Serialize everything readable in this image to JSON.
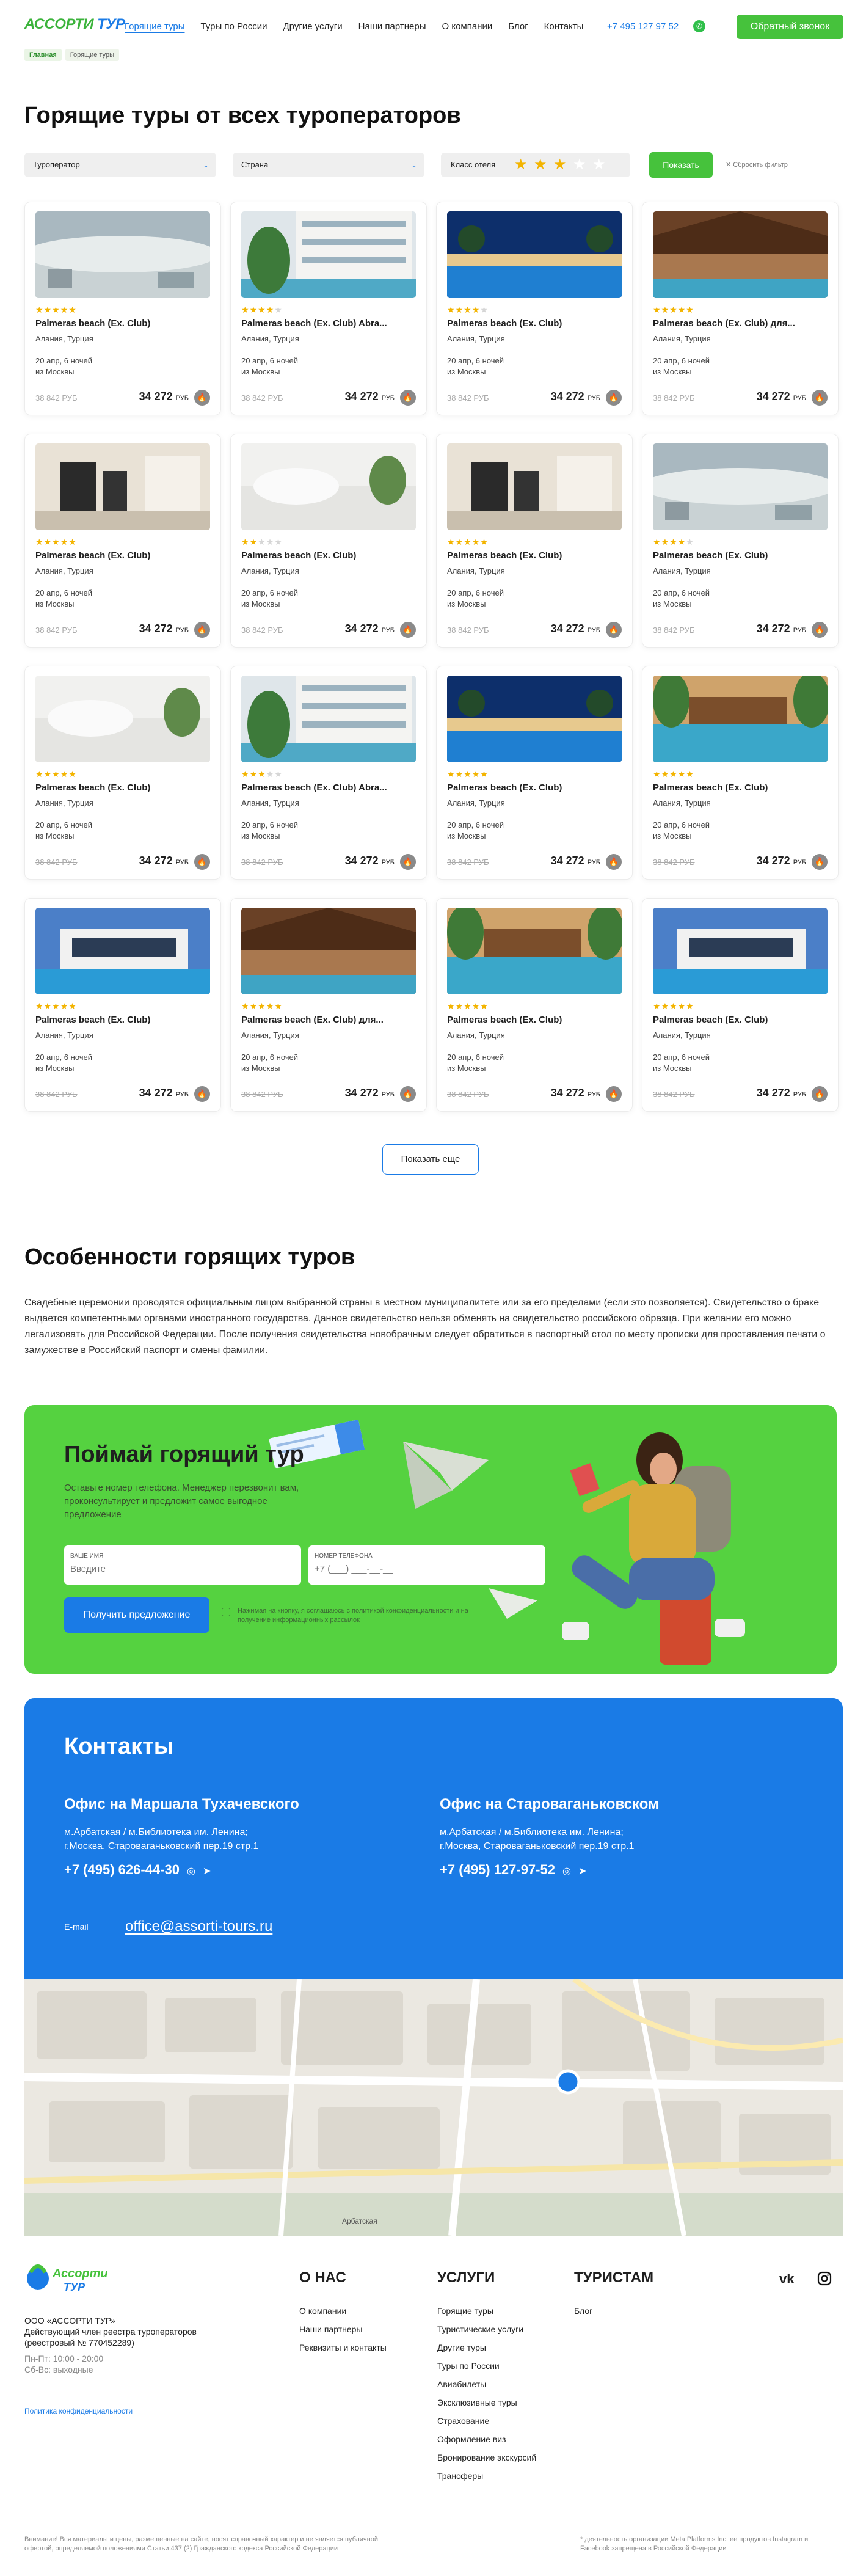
{
  "header": {
    "logo_text_a": "АССОРТИ",
    "logo_text_b": "ТУР",
    "nav": [
      "Горящие туры",
      "Туры по России",
      "Другие услуги",
      "Наши партнеры",
      "О компании",
      "Блог",
      "Контакты"
    ],
    "active_nav": "Горящие туры",
    "phone": "+7 495 127 97 52",
    "callback_label": "Обратный звонок"
  },
  "breadcrumbs": [
    "Главная",
    "Горящие туры"
  ],
  "page_title": "Горящие туры от всех туроператоров",
  "filters": {
    "operator": "Туроператор",
    "country": "Страна",
    "hotel_class": "Класс отеля",
    "stars_selected": 3,
    "stars_total": 5,
    "show_label": "Показать",
    "reset_label": "Сбросить фильтр"
  },
  "colors": {
    "green": "#46c23c",
    "blue": "#1a7be6",
    "star": "#f3b400"
  },
  "tours": [
    {
      "name": "Palmeras beach (Ex. Club)",
      "stars": 5,
      "img": "fog"
    },
    {
      "name": "Palmeras beach (Ex. Club) Abra...",
      "stars": 4,
      "img": "hotel"
    },
    {
      "name": "Palmeras beach (Ex. Club)",
      "stars": 4,
      "img": "pool-night"
    },
    {
      "name": "Palmeras beach (Ex. Club) для...",
      "stars": 5,
      "img": "wood"
    },
    {
      "name": "Palmeras beach (Ex. Club)",
      "stars": 5,
      "img": "bath"
    },
    {
      "name": "Palmeras beach (Ex. Club)",
      "stars": 2,
      "img": "bed"
    },
    {
      "name": "Palmeras beach (Ex. Club)",
      "stars": 5,
      "img": "bath"
    },
    {
      "name": "Palmeras beach (Ex. Club)",
      "stars": 4,
      "img": "fog"
    },
    {
      "name": "Palmeras beach (Ex. Club)",
      "stars": 5,
      "img": "bed"
    },
    {
      "name": "Palmeras beach (Ex. Club) Abra...",
      "stars": 3,
      "img": "hotel"
    },
    {
      "name": "Palmeras beach (Ex. Club)",
      "stars": 5,
      "img": "pool-night"
    },
    {
      "name": "Palmeras beach (Ex. Club)",
      "stars": 5,
      "img": "tropic"
    },
    {
      "name": "Palmeras beach (Ex. Club)",
      "stars": 5,
      "img": "villa"
    },
    {
      "name": "Palmeras beach (Ex. Club) для...",
      "stars": 5,
      "img": "wood"
    },
    {
      "name": "Palmeras beach (Ex. Club)",
      "stars": 5,
      "img": "tropic"
    },
    {
      "name": "Palmeras beach (Ex. Club)",
      "stars": 5,
      "img": "villa"
    }
  ],
  "tour_common": {
    "location": "Алания, Турция",
    "date": "20 апр, 6 ночей",
    "from": "из Москвы",
    "old_price": "38 842 РУБ",
    "price": "34 272",
    "currency": "РУБ"
  },
  "show_more": "Показать еще",
  "features": {
    "title": "Особенности горящих туров",
    "text": "Свадебные церемонии проводятся официальным лицом выбранной страны в местном муниципалитете или за его пределами (если это позволяется). Свидетельство о браке выдается компетентными органами иностранного государства. Данное свидетельство нельзя обменять на свидетельство российского образца. При желании его можно легализовать для Российской Федерации. После получения свидетельства новобрачным следует обратиться в паспортный стол по месту прописки для проставления печати о замужестве в Российский паспорт и смены фамилии."
  },
  "promo": {
    "title": "Поймай горящий тур",
    "desc": "Оставьте номер телефона. Менеджер перезвонит вам, проконсультирует и предложит самое выгодное предложение",
    "name_label": "Ваше имя",
    "name_placeholder": "Введите",
    "phone_label": "Номер телефона",
    "phone_placeholder": "+7 (___) ___-__-__",
    "button": "Получить предложение",
    "agree": "Нажимая на кнопку, я соглашаюсь с политикой конфиденциальности и на получение информационных рассылок"
  },
  "contacts": {
    "title": "Контакты",
    "offices": [
      {
        "name": "Офис на Маршала Тухачевского",
        "line1": "м.Арбатская / м.Библиотека им. Ленина;",
        "line2": "г.Москва, Староваганьковский пер.19 стр.1",
        "phone": "+7 (495) 626-44-30"
      },
      {
        "name": "Офис на Староваганьковском",
        "line1": "м.Арбатская / м.Библиотека им. Ленина;",
        "line2": "г.Москва, Староваганьковский пер.19 стр.1",
        "phone": "+7 (495) 127-97-52"
      }
    ],
    "email_label": "E-mail",
    "email": "office@assorti-tours.ru"
  },
  "footer": {
    "logo_a": "Ассорти",
    "logo_b": "ТУР",
    "company": "ООО «АССОРТИ ТУР»",
    "member": "Действующий член реестра туроператоров (реестровый № 770452289)",
    "hours1": "Пн-Пт: 10:00 - 20:00",
    "hours2": "Сб-Вс: выходные",
    "policy": "Политика конфиденциальности",
    "col_about": "О НАС",
    "about_items": [
      "О компании",
      "Наши партнеры",
      "Реквизиты и контакты"
    ],
    "col_services": "УСЛУГИ",
    "service_items": [
      "Горящие туры",
      "Туристические услуги",
      "Другие туры",
      "Туры по России",
      "Авиабилеты",
      "Эксклюзивные туры",
      "Страхование",
      "Оформление виз",
      "Бронирование экскурсий",
      "Трансферы"
    ],
    "col_tourists": "ТУРИСТАМ",
    "tourist_items": [
      "Блог"
    ],
    "vk": "vk",
    "legal_left": "Внимание! Вся материалы и цены, размещенные на сайте, носят справочный характер и не является публичной офертой, определяемой положениями Статьи 437 (2) Гражданского кодекса Российской Федерации",
    "legal_right": "* деятельность организации Meta Platforms Inc. ее продуктов Instagram и Facebook запрещена в Российской Федерации"
  },
  "map_labels": [
    "Арбатская"
  ]
}
